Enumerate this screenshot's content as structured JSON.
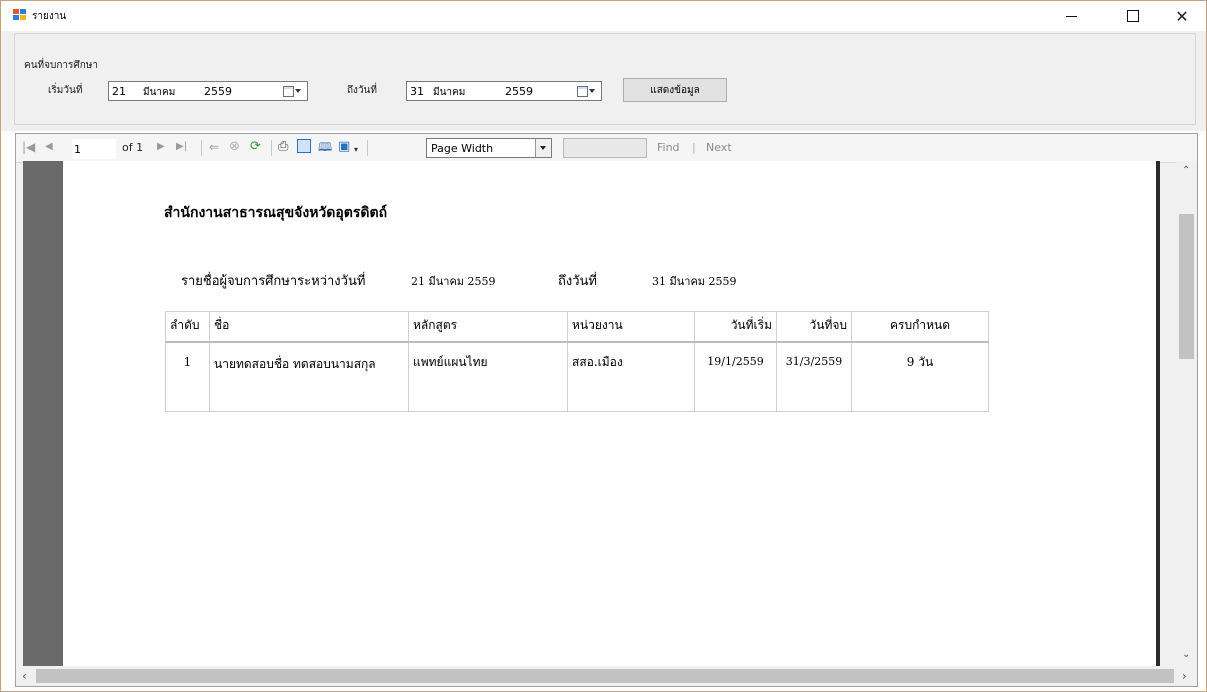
{
  "window": {
    "title": "รายงาน"
  },
  "filter": {
    "group_label": "คนที่จบการศึกษา",
    "start_label": "เริ่มวันที่",
    "start_date": {
      "day": "21",
      "month": "มีนาคม",
      "year": "2559"
    },
    "end_label": "ถึงวันที่",
    "end_date": {
      "day": "31",
      "month": "มีนาคม",
      "year": "2559"
    },
    "show_button": "แสดงข้อมูล"
  },
  "toolbar": {
    "page_value": "1",
    "page_of": "of 1",
    "zoom": "Page Width",
    "find_label": "Find",
    "find_sep": "|",
    "next_label": "Next"
  },
  "report": {
    "organization": "สำนักงานสาธารณสุขจังหวัดอุตรดิตถ์",
    "list_title": "รายชื่อผู้จบการศึกษาระหว่างวันที่",
    "start_date": "21 มีนาคม 2559",
    "to_label": "ถึงวันที่",
    "end_date": "31 มีนาคม 2559",
    "columns": [
      "ลำดับ",
      "ชื่อ",
      "หลักสูตร",
      "หน่วยงาน",
      "วันที่เริ่ม",
      "วันที่จบ",
      "ครบกำหนด"
    ],
    "rows": [
      [
        "1",
        "นายทดสอบชื่อ ทดสอบนามสกุล",
        "แพทย์แผนไทย",
        "สสอ.เมือง",
        "19/1/2559",
        "31/3/2559",
        "9 วัน"
      ]
    ]
  }
}
